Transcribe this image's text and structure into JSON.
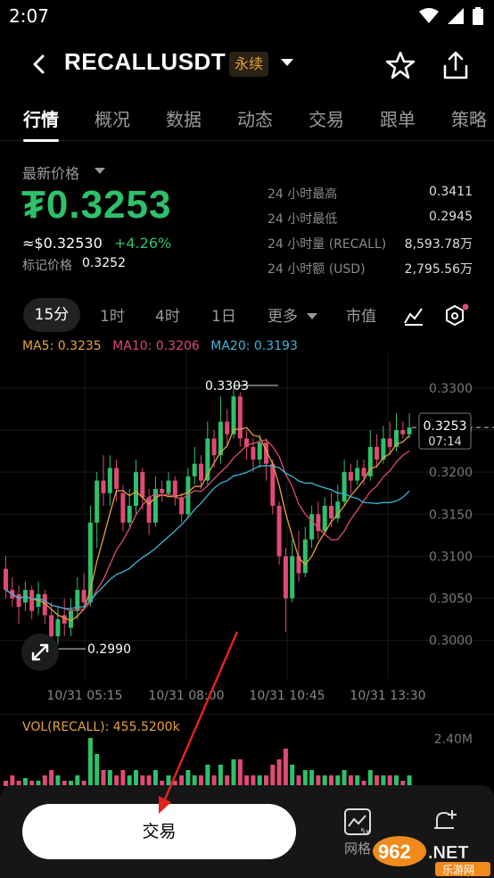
{
  "status": {
    "time": "2:07"
  },
  "header": {
    "symbol": "RECALLUSDT",
    "badge": "永续"
  },
  "tabs": [
    "行情",
    "概况",
    "数据",
    "动态",
    "交易",
    "跟单",
    "策略"
  ],
  "price": {
    "label": "最新价格",
    "last": "₮0.3253",
    "usd": "≈$0.32530",
    "change": "+4.26%",
    "mark_label": "标记价格",
    "mark_value": "0.3252"
  },
  "stats": [
    {
      "label": "24 小时最高",
      "value": "0.3411"
    },
    {
      "label": "24 小时最低",
      "value": "0.2945"
    },
    {
      "label": "24 小时量 (RECALL)",
      "value": "8,593.78万"
    },
    {
      "label": "24 小时额 (USD)",
      "value": "2,795.56万"
    }
  ],
  "intervals": {
    "active": "15分",
    "items": [
      "1时",
      "4时",
      "1日"
    ],
    "more": "更多",
    "market_cap": "市值"
  },
  "ma": {
    "ma5": "MA5: 0.3235",
    "ma10": "MA10: 0.3206",
    "ma20": "MA20: 0.3193"
  },
  "chart_data": {
    "type": "candlestick",
    "y_ticks": [
      "0.3300",
      "0.3250",
      "0.3200",
      "0.3150",
      "0.3100",
      "0.3050",
      "0.3000"
    ],
    "x_ticks": [
      "10/31 05:15",
      "10/31 08:00",
      "10/31 10:45",
      "10/31 13:30"
    ],
    "high_label": "0.3303",
    "low_label": "0.2990",
    "current_price": "0.3253",
    "countdown": "07:14",
    "ylim": [
      0.297,
      0.332
    ],
    "colors": {
      "up": "#2ec16b",
      "down": "#e04a74",
      "ma5": "#e9a23b",
      "ma10": "#e04a74",
      "ma20": "#3fb6d9"
    }
  },
  "volume": {
    "label": "VOL(RECALL): 455.5200k",
    "max": "2.40M"
  },
  "bottom": {
    "trade": "交易",
    "grid": "网格",
    "grid_badge": "5x"
  },
  "watermark": {
    "text": "962.NET",
    "sub": "乐游网"
  }
}
